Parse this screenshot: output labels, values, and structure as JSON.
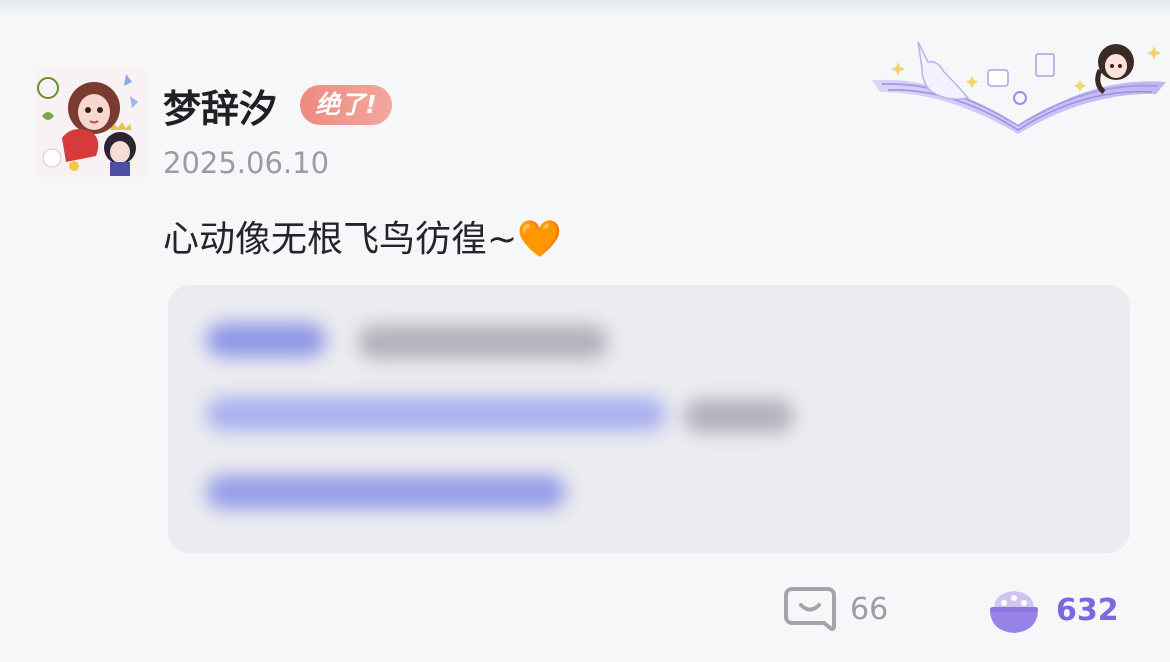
{
  "post": {
    "username": "梦辞汐",
    "badge": "绝了!",
    "date": "2025.06.10",
    "text": "心动像无根飞鸟彷徨~",
    "emoji": "🧡"
  },
  "footer": {
    "comment_count": "66",
    "like_count": "632"
  },
  "icons": {
    "comment": "comment-icon",
    "like": "rice-bowl-icon"
  },
  "colors": {
    "badge": "#ef8a80",
    "like_accent": "#7f67df",
    "muted": "#9c9ea5"
  }
}
